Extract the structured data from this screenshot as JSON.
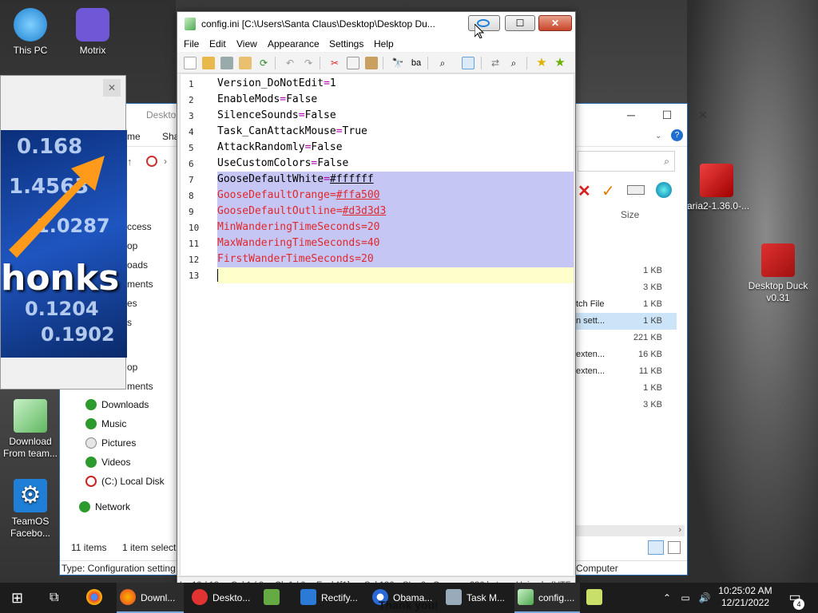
{
  "desktop": {
    "icons": [
      {
        "label": "This PC"
      },
      {
        "label": "Motrix"
      },
      {
        "label": "Download From team..."
      },
      {
        "label": "TeamOS Facebo..."
      },
      {
        "label": "aria2-1.36.0-..."
      },
      {
        "label": "Desktop Duck v0.31"
      }
    ]
  },
  "meme": {
    "caption": "honks",
    "numbers": [
      "0.168",
      "1.4563",
      "1.0287",
      "0.1204",
      "0.1902"
    ]
  },
  "explorer": {
    "title_partial": "Deskto",
    "tab_partial_home": "me",
    "tab_partial_share": "Sha",
    "nav_partial": [
      "ccess",
      "op",
      "oads",
      "ments",
      "es",
      "s",
      "op",
      "ments"
    ],
    "nav": [
      {
        "label": "Downloads"
      },
      {
        "label": "Music"
      },
      {
        "label": "Pictures"
      },
      {
        "label": "Videos"
      },
      {
        "label": "(C:) Local Disk"
      },
      {
        "label": "Network"
      }
    ],
    "column_size": "Size",
    "rows": [
      {
        "type": "",
        "size": "1 KB"
      },
      {
        "type": "",
        "size": "3 KB"
      },
      {
        "type": "tch File",
        "size": "1 KB"
      },
      {
        "type": "n sett...",
        "size": "1 KB"
      },
      {
        "type": "",
        "size": "221 KB"
      },
      {
        "type": "exten...",
        "size": "16 KB"
      },
      {
        "type": "exten...",
        "size": "11 KB"
      },
      {
        "type": "",
        "size": "1 KB"
      },
      {
        "type": "",
        "size": "3 KB"
      }
    ],
    "items_count": "11 items",
    "selected_count": "1 item select",
    "status_type": "Type: Configuration setting",
    "status_computer": "Computer"
  },
  "notepad": {
    "title": "config.ini [C:\\Users\\Santa Claus\\Desktop\\Desktop Du...",
    "menu": [
      "File",
      "Edit",
      "View",
      "Appearance",
      "Settings",
      "Help"
    ],
    "lines": [
      {
        "n": "1",
        "key": "Version_DoNotEdit",
        "eq": "=",
        "val": "1",
        "state": "normal"
      },
      {
        "n": "2",
        "key": "EnableMods",
        "eq": "=",
        "val": "False",
        "state": "normal"
      },
      {
        "n": "3",
        "key": "SilenceSounds",
        "eq": "=",
        "val": "False",
        "state": "normal"
      },
      {
        "n": "4",
        "key": "Task_CanAttackMouse",
        "eq": "=",
        "val": "True",
        "state": "normal"
      },
      {
        "n": "5",
        "key": "AttackRandomly",
        "eq": "=",
        "val": "False",
        "state": "normal"
      },
      {
        "n": "6",
        "key": "UseCustomColors",
        "eq": "=",
        "val": "False",
        "state": "normal"
      },
      {
        "n": "7",
        "key": "GooseDefaultWhite",
        "eq": "=",
        "val": "#ffffff",
        "state": "sel-black"
      },
      {
        "n": "8",
        "key": "GooseDefaultOrange",
        "eq": "=",
        "val": "#ffa500",
        "state": "sel-red"
      },
      {
        "n": "9",
        "key": "GooseDefaultOutline",
        "eq": "=",
        "val": "#d3d3d3",
        "state": "sel-red"
      },
      {
        "n": "10",
        "key": "MinWanderingTimeSeconds",
        "eq": "=",
        "val": "20",
        "state": "sel-red"
      },
      {
        "n": "11",
        "key": "MaxWanderingTimeSeconds",
        "eq": "=",
        "val": "40",
        "state": "sel-red"
      },
      {
        "n": "12",
        "key": "FirstWanderTimeSeconds",
        "eq": "=",
        "val": "20",
        "state": "sel-red"
      },
      {
        "n": "13",
        "key": "",
        "eq": "",
        "val": "",
        "state": "cursor"
      }
    ],
    "status": {
      "ln": "Ln 13 / 13",
      "col": "Col 1 / 0",
      "ch": "Ch 1 / 0",
      "eval": "Eval ^[1]",
      "sel": "Sel 136",
      "sln": "SLn 6",
      "occ": "Occ --",
      "bytes": "286 bytes",
      "enc": "Unicode (UTF-"
    }
  },
  "taskbar": {
    "items": [
      {
        "label": "Downl..."
      },
      {
        "label": "Deskto..."
      },
      {
        "label": "Rectify..."
      },
      {
        "label": "Obama..."
      },
      {
        "label": "Task M..."
      },
      {
        "label": "config...."
      }
    ],
    "behind_text": "Thank you!",
    "time": "10:25:02 AM",
    "date": "12/21/2022",
    "notifications": "4"
  },
  "colors": {
    "selection": "#c6c6f5",
    "current_line": "#ffffcc",
    "red_text": "#e0282a",
    "operator": "#b000b0"
  }
}
